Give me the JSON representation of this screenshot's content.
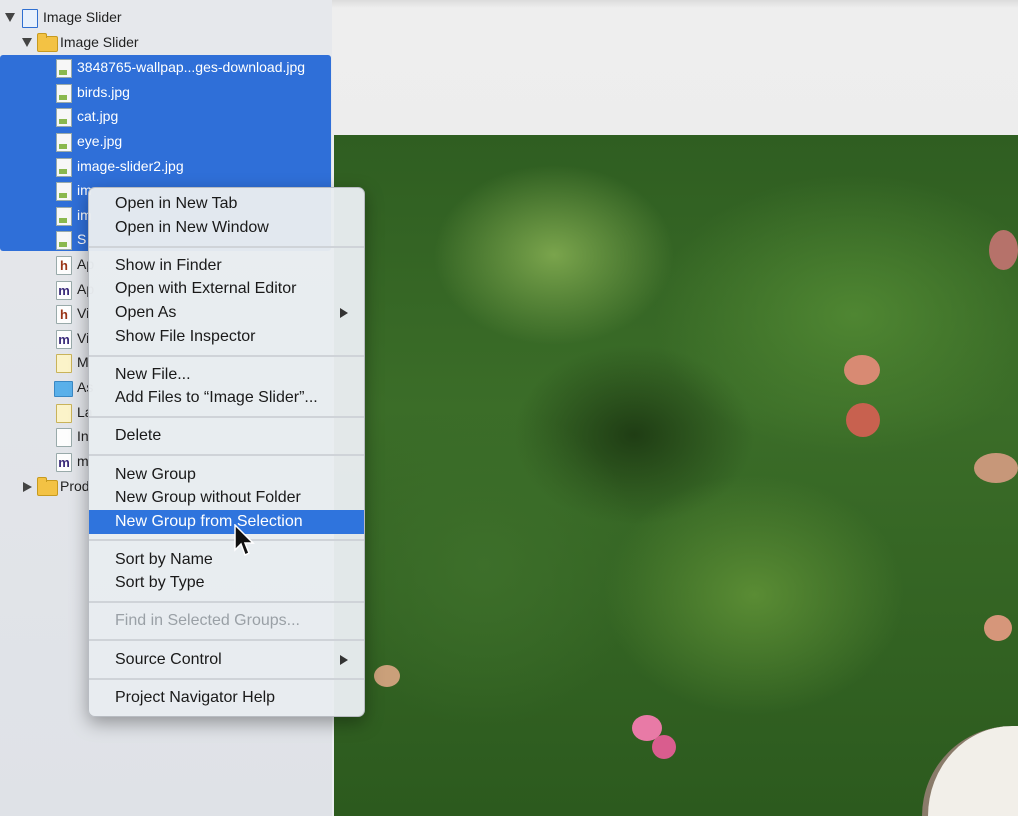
{
  "navigator": {
    "project": "Image Slider",
    "group": "Image Slider",
    "files": [
      {
        "label": "3848765-wallpap...ges-download.jpg",
        "kind": "image",
        "selected": true
      },
      {
        "label": "birds.jpg",
        "kind": "image",
        "selected": true
      },
      {
        "label": "cat.jpg",
        "kind": "image",
        "selected": true
      },
      {
        "label": "eye.jpg",
        "kind": "image",
        "selected": true
      },
      {
        "label": "image-slider2.jpg",
        "kind": "image",
        "selected": true
      },
      {
        "label": "im",
        "kind": "image",
        "selected": true
      },
      {
        "label": "im",
        "kind": "image",
        "selected": true
      },
      {
        "label": "S",
        "kind": "image",
        "selected": true
      },
      {
        "label": "Ap",
        "kind": "header",
        "selected": false
      },
      {
        "label": "Ap",
        "kind": "source",
        "selected": false
      },
      {
        "label": "Vi",
        "kind": "header",
        "selected": false
      },
      {
        "label": "Vi",
        "kind": "source",
        "selected": false
      },
      {
        "label": "M",
        "kind": "storyboard",
        "selected": false
      },
      {
        "label": "As",
        "kind": "assets",
        "selected": false
      },
      {
        "label": "La",
        "kind": "storyboard",
        "selected": false
      },
      {
        "label": "In",
        "kind": "plist",
        "selected": false
      },
      {
        "label": "m",
        "kind": "source",
        "selected": false
      }
    ],
    "products_group": "Prod"
  },
  "context_menu": {
    "items": [
      {
        "label": "Open in New Tab"
      },
      {
        "label": "Open in New Window"
      },
      {
        "label": "Show in Finder"
      },
      {
        "label": "Open with External Editor"
      },
      {
        "label": "Open As",
        "submenu": true
      },
      {
        "label": "Show File Inspector"
      },
      {
        "label": "New File..."
      },
      {
        "label": "Add Files to “Image Slider”..."
      },
      {
        "label": "Delete"
      },
      {
        "label": "New Group"
      },
      {
        "label": "New Group without Folder"
      },
      {
        "label": "New Group from Selection",
        "highlighted": true
      },
      {
        "label": "Sort by Name"
      },
      {
        "label": "Sort by Type"
      },
      {
        "label": "Find in Selected Groups...",
        "disabled": true
      },
      {
        "label": "Source Control",
        "submenu": true
      },
      {
        "label": "Project Navigator Help"
      }
    ]
  },
  "colors": {
    "selection": "#2f6fd8",
    "menu_highlight": "#2f74dd"
  }
}
